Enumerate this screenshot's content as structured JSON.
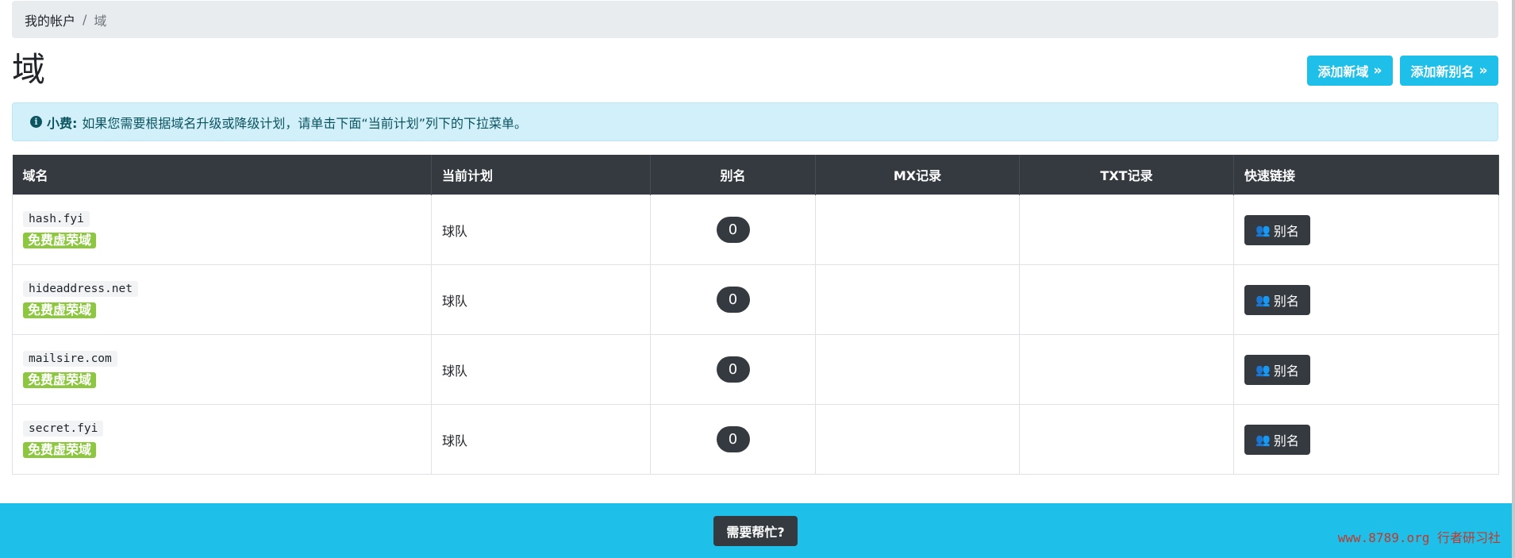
{
  "breadcrumb": {
    "account": "我的帐户",
    "separator": "/",
    "current": "域"
  },
  "page": {
    "title": "域"
  },
  "actions": {
    "add_domain": "添加新域",
    "add_alias": "添加新别名",
    "chevron": "»"
  },
  "alert": {
    "icon": "info-circle-icon",
    "strong": "小费:",
    "text": "如果您需要根据域名升级或降级计划，请单击下面“当前计划”列下的下拉菜单。"
  },
  "table": {
    "headers": [
      "域名",
      "当前计划",
      "别名",
      "MX记录",
      "TXT记录",
      "快速链接"
    ],
    "rows": [
      {
        "domain": "hash.fyi",
        "badge": "免费虚荣域",
        "plan": "球队",
        "aliases": "0",
        "quick_link": "别名"
      },
      {
        "domain": "hideaddress.net",
        "badge": "免费虚荣域",
        "plan": "球队",
        "aliases": "0",
        "quick_link": "别名"
      },
      {
        "domain": "mailsire.com",
        "badge": "免费虚荣域",
        "plan": "球队",
        "aliases": "0",
        "quick_link": "别名"
      },
      {
        "domain": "secret.fyi",
        "badge": "免费虚荣域",
        "plan": "球队",
        "aliases": "0",
        "quick_link": "别名"
      }
    ]
  },
  "footer": {
    "help": "需要帮忙?",
    "watermark": "www.8789.org 行者研习社"
  },
  "colors": {
    "accent": "#1ec0e9",
    "dark": "#343a40",
    "badge": "#8dc63f",
    "alert_bg": "#d1f0fa"
  }
}
